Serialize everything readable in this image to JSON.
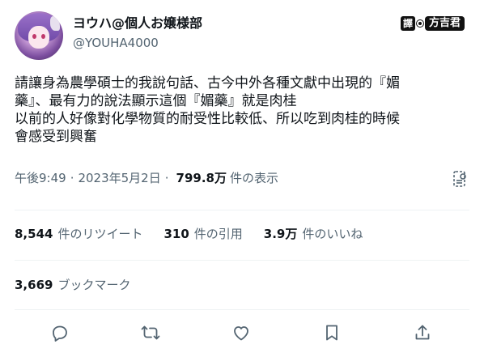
{
  "user": {
    "display_name": "ヨウハ@個人お嬢様部",
    "handle": "@YOUHA4000"
  },
  "stamp": {
    "label": "譯",
    "name": "方吉君"
  },
  "tweet": {
    "lines": [
      "請讓身為農學碩士的我說句話、古今中外各種文獻中出現的『媚",
      "藥』、最有力的說法顯示這個『媚藥』就是肉桂",
      "以前的人好像對化學物質的耐受性比較低、所以吃到肉桂的時候",
      "會感受到興奮"
    ]
  },
  "meta": {
    "time": "午後9:49",
    "sep1": "·",
    "date": "2023年5月2日",
    "sep2": "·",
    "views_count": "799.8万",
    "views_label": "件の表示"
  },
  "stats": {
    "retweets_count": "8,544",
    "retweets_label": "件のリツイート",
    "quotes_count": "310",
    "quotes_label": "件の引用",
    "likes_count": "3.9万",
    "likes_label": "件のいいね"
  },
  "bookmarks": {
    "count": "3,669",
    "label": "ブックマーク"
  },
  "actions": {
    "icons": [
      "reply-icon",
      "retweet-icon",
      "like-icon",
      "bookmark-icon",
      "share-icon"
    ]
  }
}
